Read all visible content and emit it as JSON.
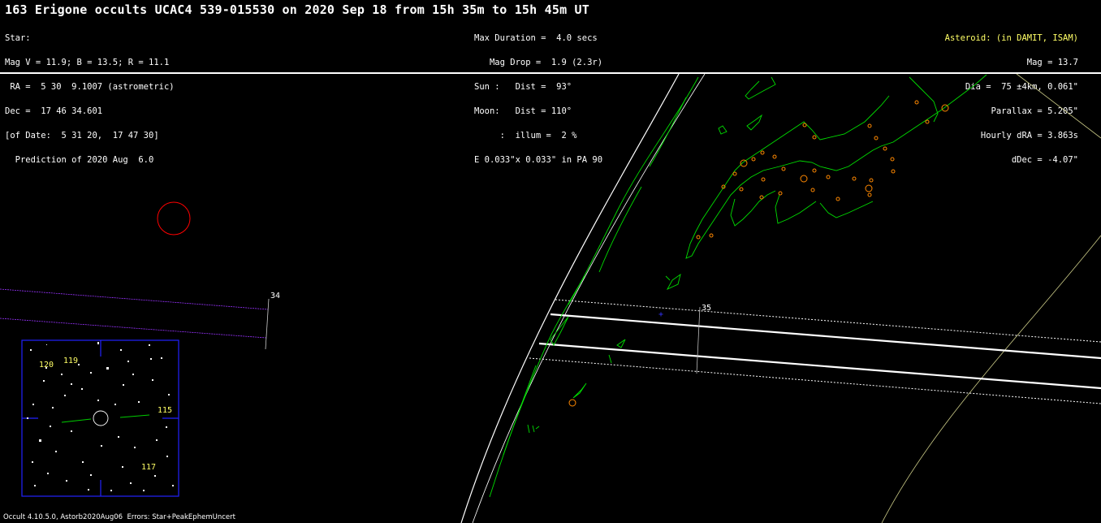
{
  "header": {
    "title": "163 Erigone occults UCAC4 539-015530 on 2020 Sep 18 from 15h 35m to 15h 45m UT",
    "star_lines": [
      "Star:",
      "Mag V = 11.9; B = 13.5; R = 11.1",
      " RA =  5 30  9.1007 (astrometric)",
      "Dec =  17 46 34.601",
      "[of Date:  5 31 20,  17 47 30]",
      "  Prediction of 2020 Aug  6.0"
    ],
    "event_lines": [
      "Max Duration =  4.0 secs",
      "   Mag Drop =  1.9 (2.3r)",
      "Sun :   Dist =  93°",
      "Moon:   Dist = 110°",
      "     :  illum =  2 %",
      "E 0.033\"x 0.033\" in PA 90"
    ],
    "asteroid_title": "Asteroid: (in DAMIT, ISAM)",
    "asteroid_lines": [
      "Mag = 13.7",
      "Dia =  75 ±4km, 0.061\"",
      "Parallax = 5.205\"",
      "Hourly dRA = 3.863s",
      "dDec = -4.07\""
    ]
  },
  "map": {
    "time_labels": [
      "34",
      "35"
    ],
    "finder_labels": [
      "120",
      "119",
      "115",
      "117"
    ],
    "colors": {
      "background": "#000000",
      "path": "#ffffff",
      "coastline": "#00dd00",
      "sites": "#ff8800",
      "early_path": "#9933ff",
      "finder_frame": "#0000ff",
      "finder_label": "#ffff66",
      "sun_marker": "#ff0000"
    }
  },
  "footer": "Occult 4.10.5.0, Astorb2020Aug06  Errors: Star+PeakEphemUncert"
}
